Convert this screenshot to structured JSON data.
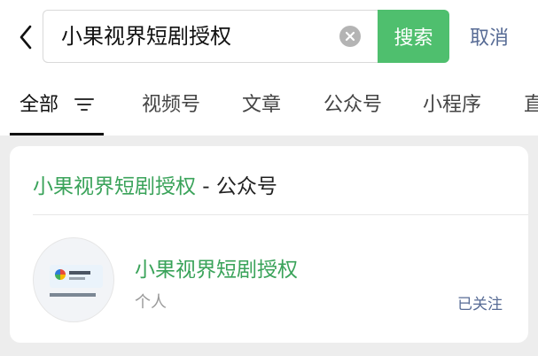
{
  "search": {
    "query": "小果视界短剧授权",
    "button_label": "搜索",
    "cancel_label": "取消"
  },
  "tabs": [
    {
      "label": "全部"
    },
    {
      "label": "视频号"
    },
    {
      "label": "文章"
    },
    {
      "label": "公众号"
    },
    {
      "label": "小程序"
    },
    {
      "label": "直"
    }
  ],
  "result": {
    "section_title_name": "小果视界短剧授权",
    "section_title_separator": " - ",
    "section_title_category": "公众号",
    "account_name": "小果视界短剧授权",
    "account_type": "个人",
    "follow_status": "已关注"
  },
  "colors": {
    "accent_green": "#4fbf6e",
    "highlight_green": "#3aa35a",
    "link_blue": "#576b95",
    "background": "#ededed"
  },
  "icons": [
    "back-arrow-icon",
    "clear-icon",
    "filter-icon",
    "avatar-image"
  ]
}
